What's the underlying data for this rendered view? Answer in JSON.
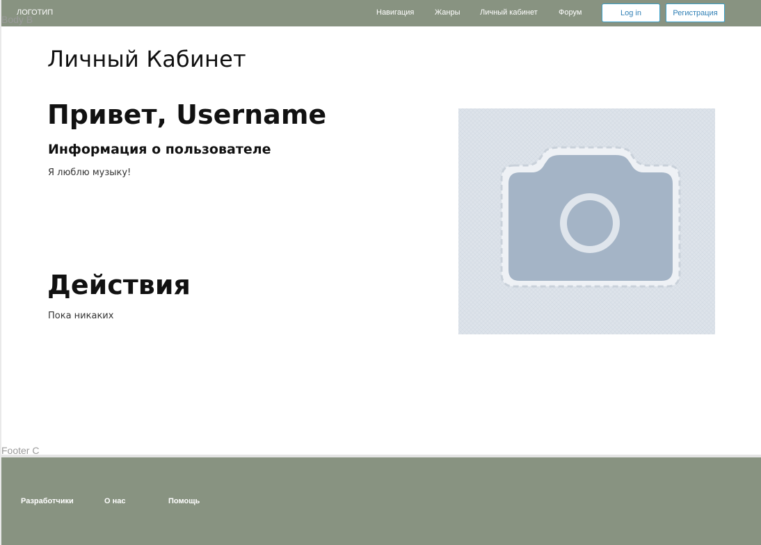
{
  "header": {
    "logo": "ЛОГОТИП",
    "nav": [
      "Навигация",
      "Жанры",
      "Личный кабинет",
      "Форум"
    ],
    "login_label": "Log in",
    "register_label": "Регистрация"
  },
  "frame_labels": {
    "body": "Body B",
    "footer": "Footer C"
  },
  "main": {
    "page_title": "Личный Кабинет",
    "greeting": "Привет, Username",
    "info_heading": "Информация о пользователе",
    "info_text": "Я люблю музыку!",
    "actions_heading": "Действия",
    "actions_text": "Пока никаких",
    "photo_icon": "camera-icon"
  },
  "footer": {
    "links": [
      "Разработчики",
      "О нас",
      "Помощь"
    ]
  },
  "colors": {
    "header_bg": "#889381",
    "footer_bg": "#889381",
    "button_border": "#3aa0c8",
    "photo_bg": "#dde3ea",
    "camera": "#a4b4c6"
  }
}
